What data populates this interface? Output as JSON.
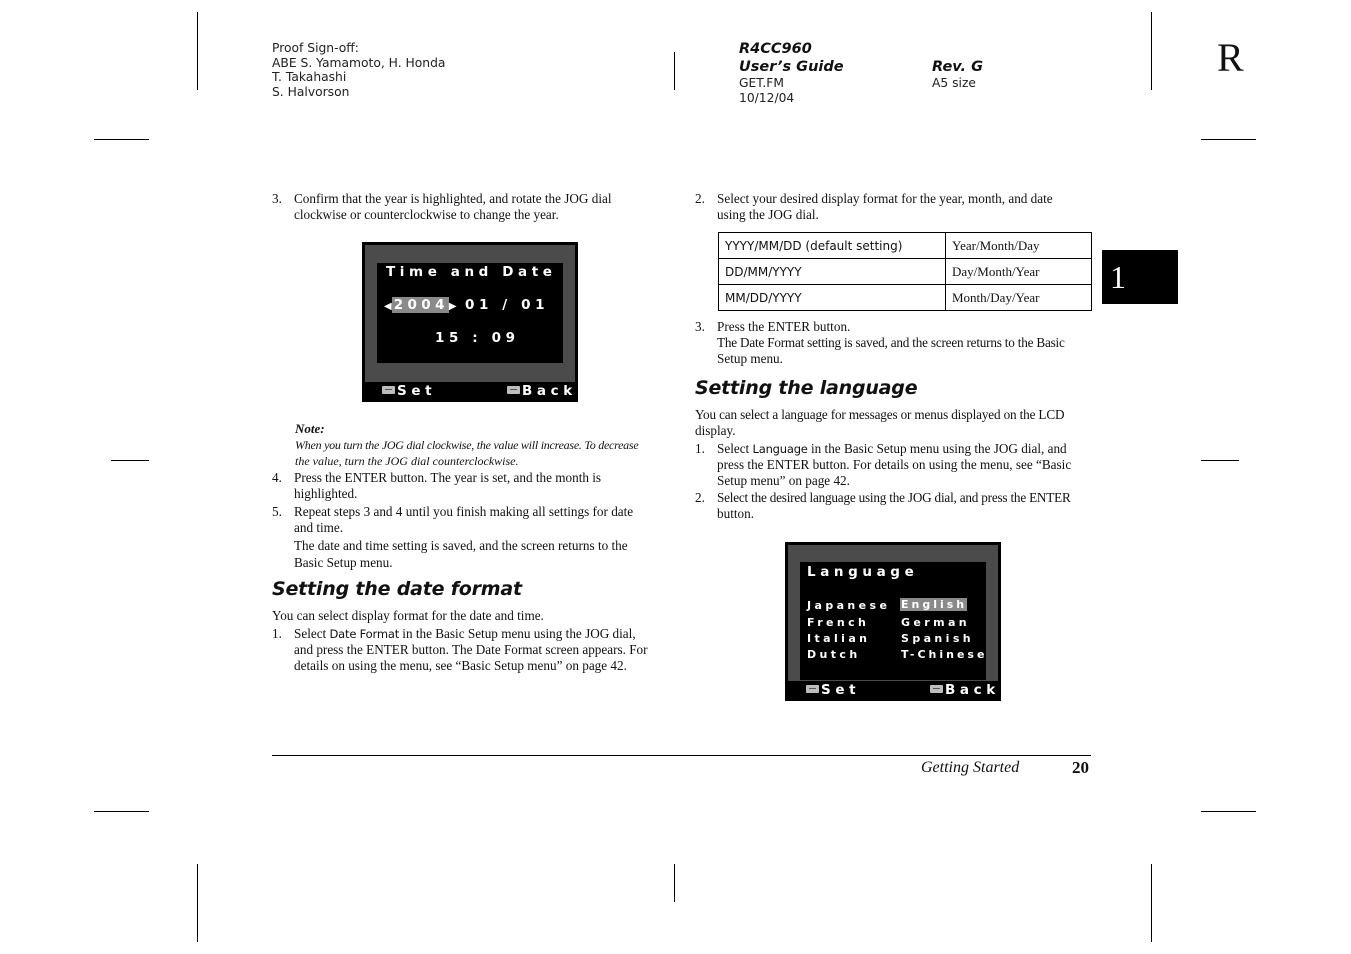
{
  "header": {
    "proof_signoff": [
      "Proof Sign-off:",
      "ABE S. Yamamoto, H. Honda",
      "T. Takahashi",
      "S. Halvorson"
    ],
    "model": "R4CC960",
    "guide_title": "User’s Guide",
    "file": "GET.FM",
    "date": "10/12/04",
    "revision": "Rev. G",
    "size": "A5 size",
    "corner_mark": "R"
  },
  "chapter_tab": "1",
  "left_column": {
    "step3": {
      "num": "3.",
      "lines": [
        "Confirm that the year is highlighted, and rotate the JOG dial",
        "clockwise or counterclockwise to change the year."
      ]
    },
    "time_date_screen": {
      "title": "Time and Date",
      "year": "2004",
      "month_day": "01 / 01",
      "time": "15 : 09",
      "left_arrow": "◀",
      "right_arrow": "▶",
      "set_label": "Set",
      "back_label": "Back",
      "highlight_color": "#8a8a8a"
    },
    "note": {
      "label": "Note:",
      "lines": [
        "When you turn the JOG dial clockwise, the value will increase. To decrease",
        "the value, turn the JOG dial counterclockwise."
      ]
    },
    "step4": {
      "num": "4.",
      "lines": [
        "Press the ENTER button. The year is set, and the month is",
        "highlighted."
      ]
    },
    "step5": {
      "num": "5.",
      "lines": [
        "Repeat steps 3 and 4 until you finish making all settings for date",
        "and time."
      ],
      "follow": [
        "The date and time setting is saved, and the screen returns to the",
        "Basic Setup menu."
      ]
    },
    "date_format_heading": "Setting the date format",
    "date_format_intro": "You can select display format for the date and time.",
    "df_step1": {
      "num": "1.",
      "pre": "Select ",
      "ui": "Date Format",
      "post": " in the Basic Setup menu using the JOG dial,",
      "lines": [
        "and press the ENTER button. The Date Format screen appears. For",
        "details on using the menu, see “Basic Setup menu” on page 42."
      ]
    }
  },
  "right_column": {
    "df_step2": {
      "num": "2.",
      "lines": [
        "Select your desired display format for the year, month, and date",
        "using the JOG dial."
      ]
    },
    "format_table": [
      {
        "format": "YYYY/MM/DD (default setting)",
        "meaning": "Year/Month/Day"
      },
      {
        "format": "DD/MM/YYYY",
        "meaning": "Day/Month/Year"
      },
      {
        "format": "MM/DD/YYYY",
        "meaning": "Month/Day/Year"
      }
    ],
    "df_step3": {
      "num": "3.",
      "line": "Press the ENTER button.",
      "follow": [
        "The Date Format setting is saved, and the screen returns to the Basic",
        "Setup menu."
      ]
    },
    "language_heading": "Setting the language",
    "language_intro": [
      "You can select a language for messages or menus displayed on the LCD",
      "display."
    ],
    "lang_step1": {
      "num": "1.",
      "pre": "Select ",
      "ui": "Language",
      "post": " in the Basic Setup menu using the JOG dial, and",
      "lines": [
        "press the ENTER button. For details on using the menu, see “Basic",
        "Setup menu” on page 42."
      ]
    },
    "lang_step2": {
      "num": "2.",
      "lines": [
        "Select the desired language using the JOG dial, and press the ENTER",
        "button."
      ]
    },
    "language_screen": {
      "title": "Language",
      "options_left": [
        "Japanese",
        "French",
        "Italian",
        "Dutch"
      ],
      "options_right": [
        "English",
        "German",
        "Spanish",
        "T-Chinese"
      ],
      "selected": "English",
      "set_label": "Set",
      "back_label": "Back"
    }
  },
  "footer": {
    "section": "Getting Started",
    "page_number": "20"
  }
}
